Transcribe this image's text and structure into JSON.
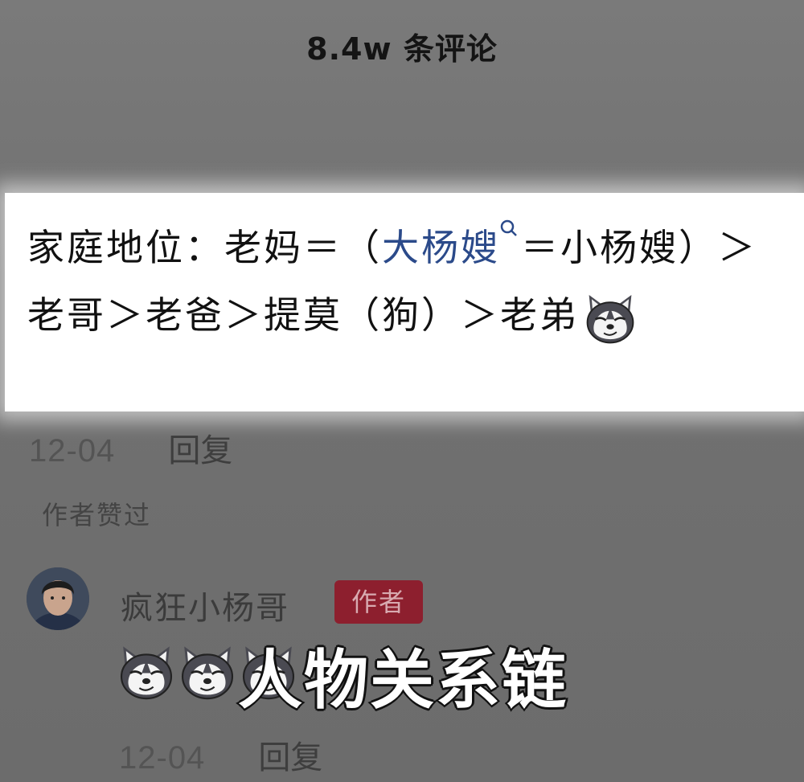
{
  "header": {
    "title": "8.4w 条评论"
  },
  "comment": {
    "text_before": "家庭地位：老妈＝（",
    "link_text": "大杨嫂",
    "text_after": "＝小杨嫂）＞老哥＞老爸＞提莫（狗）＞老弟",
    "emoji": "dog-emoji",
    "date": "12-04",
    "reply_label": "回复",
    "author_liked": "作者赞过"
  },
  "reply": {
    "username": "疯狂小杨哥",
    "author_badge": "作者",
    "emojis": [
      "dog-emoji",
      "dog-emoji",
      "dog-emoji"
    ],
    "date": "12-04",
    "reply_label": "回复"
  },
  "overlay": {
    "caption": "人物关系链"
  },
  "colors": {
    "background": "#707070",
    "link": "#2b4a8a",
    "author_badge": "#8d1f2e",
    "highlight": "#ffffff"
  }
}
